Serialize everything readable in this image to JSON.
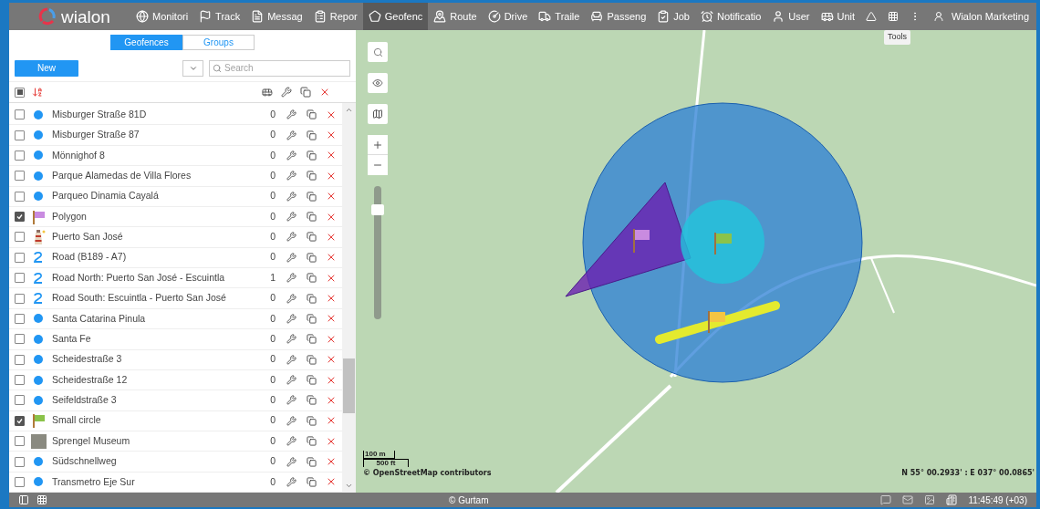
{
  "nav": {
    "logo": "wialon",
    "items": [
      {
        "label": "Monitori",
        "selected": false
      },
      {
        "label": "Track",
        "selected": false
      },
      {
        "label": "Messag",
        "selected": false
      },
      {
        "label": "Repor",
        "selected": false
      },
      {
        "label": "Geofenc",
        "selected": true
      },
      {
        "label": "Route",
        "selected": false
      },
      {
        "label": "Drive",
        "selected": false
      },
      {
        "label": "Traile",
        "selected": false
      },
      {
        "label": "Passeng",
        "selected": false
      },
      {
        "label": "Job",
        "selected": false
      },
      {
        "label": "Notificatio",
        "selected": false
      },
      {
        "label": "User",
        "selected": false
      },
      {
        "label": "Unit",
        "selected": false
      }
    ],
    "user": "Wialon Marketing",
    "tooltip": "Tools"
  },
  "panel": {
    "tabs": [
      {
        "label": "Geofences",
        "selected": true
      },
      {
        "label": "Groups",
        "selected": false
      }
    ],
    "new_button": "New",
    "search": {
      "placeholder": "Search"
    },
    "header": {
      "indeterminate": true
    },
    "rows": [
      {
        "name": "Misburger Straße 81D",
        "kind": "dot",
        "checked": false,
        "count": "0"
      },
      {
        "name": "Misburger Straße 87",
        "kind": "dot",
        "checked": false,
        "count": "0"
      },
      {
        "name": "Mönnighof 8",
        "kind": "dot",
        "checked": false,
        "count": "0"
      },
      {
        "name": "Parque Alamedas de Villa Flores",
        "kind": "dot",
        "checked": false,
        "count": "0"
      },
      {
        "name": "Parqueo Dinamia Cayalá",
        "kind": "dot",
        "checked": false,
        "count": "0"
      },
      {
        "name": "Polygon",
        "kind": "flag",
        "color": "#c98be0",
        "checked": true,
        "count": "0"
      },
      {
        "name": "Puerto San José",
        "kind": "tower",
        "checked": false,
        "count": "0"
      },
      {
        "name": "Road (B189 - A7)",
        "kind": "road",
        "checked": false,
        "count": "0"
      },
      {
        "name": "Road North: Puerto San José - Escuintla",
        "kind": "road",
        "checked": false,
        "count": "1"
      },
      {
        "name": "Road South: Escuintla - Puerto San José",
        "kind": "road",
        "checked": false,
        "count": "0"
      },
      {
        "name": "Santa Catarina Pinula",
        "kind": "dot",
        "checked": false,
        "count": "0"
      },
      {
        "name": "Santa Fe",
        "kind": "dot",
        "checked": false,
        "count": "0"
      },
      {
        "name": "Scheidestraße 3",
        "kind": "dot",
        "checked": false,
        "count": "0"
      },
      {
        "name": "Scheidestraße 12",
        "kind": "dot",
        "checked": false,
        "count": "0"
      },
      {
        "name": "Seifeldstraße 3",
        "kind": "dot",
        "checked": false,
        "count": "0"
      },
      {
        "name": "Small circle",
        "kind": "flag",
        "color": "#8bc34a",
        "checked": true,
        "count": "0"
      },
      {
        "name": "Sprengel Museum",
        "kind": "photo",
        "checked": false,
        "count": "0"
      },
      {
        "name": "Südschnellweg",
        "kind": "dot",
        "checked": false,
        "count": "0"
      },
      {
        "name": "Transmetro Eje Sur",
        "kind": "dot",
        "checked": false,
        "count": "0"
      }
    ]
  },
  "map": {
    "zoom": {
      "level": 0.82
    },
    "scale": [
      "100 m",
      "500 ft"
    ],
    "attribution": "© OpenStreetMap contributors",
    "coordinates": "N 55° 00.2933' : E 037° 00.0865'"
  },
  "footer": {
    "copyright": "© Gurtam",
    "time": "11:45:49 (+03)"
  }
}
